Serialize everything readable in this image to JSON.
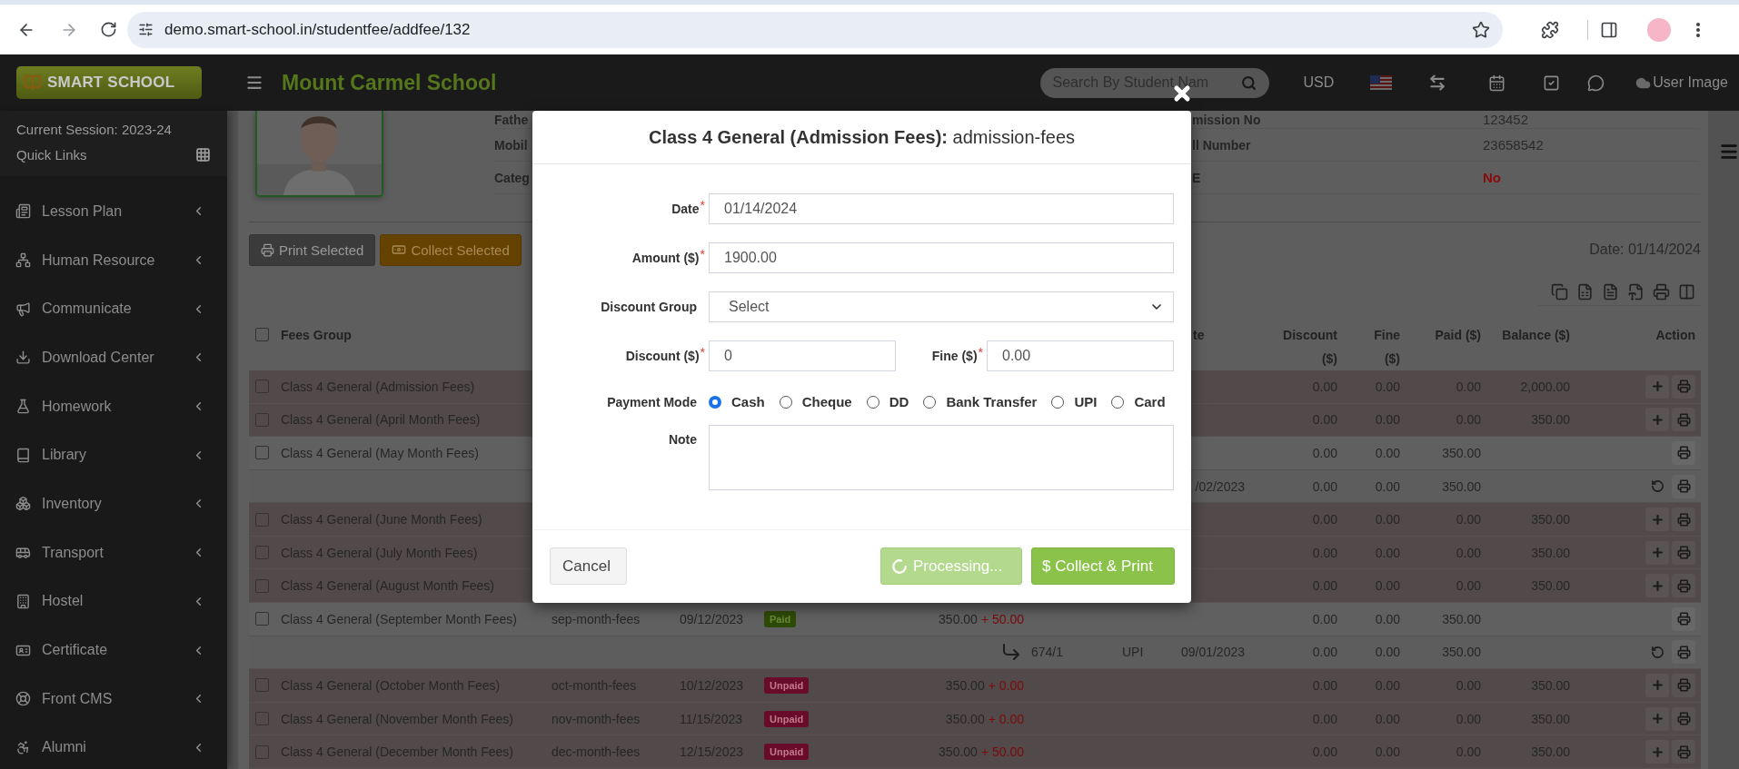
{
  "browser": {
    "url": "demo.smart-school.in/studentfee/addfee/132"
  },
  "header": {
    "logo": "SMART SCHOOL",
    "school": "Mount Carmel School",
    "search": {
      "placeholder": "Search By Student Nam"
    },
    "currency": "USD",
    "user": "User Image"
  },
  "sidebar": {
    "session": "Current Session: 2023-24",
    "quick_links": "Quick Links",
    "items": [
      {
        "label": "Lesson Plan",
        "selected": false
      },
      {
        "label": "Human Resource",
        "selected": false
      },
      {
        "label": "Communicate",
        "selected": false
      },
      {
        "label": "Download Center",
        "selected": false
      },
      {
        "label": "Homework",
        "selected": false
      },
      {
        "label": "Library",
        "selected": false
      },
      {
        "label": "Inventory",
        "selected": false
      },
      {
        "label": "Transport",
        "selected": false
      },
      {
        "label": "Hostel",
        "selected": false
      },
      {
        "label": "Certificate",
        "selected": false
      },
      {
        "label": "Front CMS",
        "selected": false
      },
      {
        "label": "Alumni",
        "selected": false
      }
    ]
  },
  "student": {
    "info_left": [
      {
        "label": "Fathe"
      },
      {
        "label": "Mobil"
      },
      {
        "label": "Categ"
      }
    ],
    "info_right": [
      {
        "label": "mission No",
        "value": "123452",
        "kind": "plain"
      },
      {
        "label": "ll Number",
        "value": "23658542",
        "kind": "plain"
      },
      {
        "label": "E",
        "value": "No",
        "kind": "alert"
      }
    ]
  },
  "toolbar": {
    "print_selected": "Print Selected",
    "collect_selected": "Collect Selected",
    "date": "Date: 01/14/2024"
  },
  "table": {
    "select_all": {
      "checked": false
    },
    "columns": [
      {
        "label": "Fees Group"
      },
      {
        "label": "te"
      },
      {
        "label": "Discount ($)"
      },
      {
        "label": "Fine ($)"
      },
      {
        "label": "Paid ($)"
      },
      {
        "label": "Balance ($)"
      },
      {
        "label": "Action"
      }
    ],
    "rows": [
      {
        "kind": "fee",
        "checked": false,
        "settled": false,
        "name": "Class 4 General (Admission Fees)",
        "discount": "0.00",
        "fine": "0.00",
        "paid": "0.00",
        "balance": "2,000.00",
        "actions": [
          {
            "kind": "collect"
          },
          {
            "kind": "print"
          }
        ]
      },
      {
        "kind": "fee",
        "checked": false,
        "settled": false,
        "name": "Class 4 General (April Month Fees)",
        "discount": "0.00",
        "fine": "0.00",
        "paid": "0.00",
        "balance": "350.00",
        "actions": [
          {
            "kind": "collect"
          },
          {
            "kind": "print"
          }
        ]
      },
      {
        "kind": "fee",
        "checked": false,
        "settled": true,
        "name": "Class 4 General (May Month Fees)",
        "discount": "0.00",
        "fine": "0.00",
        "paid": "350.00",
        "actions": [
          {
            "kind": "print"
          }
        ]
      },
      {
        "kind": "payment",
        "date": "/02/2023",
        "discount": "0.00",
        "fine": "0.00",
        "paid": "350.00",
        "actions": [
          {
            "kind": "revert"
          },
          {
            "kind": "print"
          }
        ]
      },
      {
        "kind": "fee",
        "checked": false,
        "settled": false,
        "name": "Class 4 General (June Month Fees)",
        "discount": "0.00",
        "fine": "0.00",
        "paid": "0.00",
        "balance": "350.00",
        "actions": [
          {
            "kind": "collect"
          },
          {
            "kind": "print"
          }
        ]
      },
      {
        "kind": "fee",
        "checked": false,
        "settled": false,
        "name": "Class 4 General (July Month Fees)",
        "discount": "0.00",
        "fine": "0.00",
        "paid": "0.00",
        "balance": "350.00",
        "actions": [
          {
            "kind": "collect"
          },
          {
            "kind": "print"
          }
        ]
      },
      {
        "kind": "fee",
        "checked": false,
        "settled": false,
        "name": "Class 4 General (August Month Fees)",
        "discount": "0.00",
        "fine": "0.00",
        "paid": "0.00",
        "balance": "350.00",
        "actions": [
          {
            "kind": "collect"
          },
          {
            "kind": "print"
          }
        ]
      },
      {
        "kind": "fee",
        "checked": false,
        "settled": true,
        "name": "Class 4 General (September Month Fees)",
        "code": "sep-month-fees",
        "due": "09/12/2023",
        "badge": "Paid",
        "amount": "350.00",
        "extra": "+ 50.00",
        "discount": "0.00",
        "fine": "0.00",
        "paid": "350.00",
        "actions": [
          {
            "kind": "print"
          }
        ]
      },
      {
        "kind": "payment",
        "id": "674/1",
        "mode": "UPI",
        "date": "09/01/2023",
        "discount": "0.00",
        "fine": "0.00",
        "paid": "350.00",
        "actions": [
          {
            "kind": "revert"
          },
          {
            "kind": "print"
          }
        ]
      },
      {
        "kind": "fee",
        "checked": false,
        "settled": false,
        "name": "Class 4 General (October Month Fees)",
        "code": "oct-month-fees",
        "due": "10/12/2023",
        "badge": "Unpaid",
        "amount": "350.00",
        "extra": "+ 0.00",
        "discount": "0.00",
        "fine": "0.00",
        "paid": "0.00",
        "balance": "350.00",
        "actions": [
          {
            "kind": "collect"
          },
          {
            "kind": "print"
          }
        ]
      },
      {
        "kind": "fee",
        "checked": false,
        "settled": false,
        "name": "Class 4 General (November Month Fees)",
        "code": "nov-month-fees",
        "due": "11/15/2023",
        "badge": "Unpaid",
        "amount": "350.00",
        "extra": "+ 0.00",
        "discount": "0.00",
        "fine": "0.00",
        "paid": "0.00",
        "balance": "350.00",
        "actions": [
          {
            "kind": "collect"
          },
          {
            "kind": "print"
          }
        ]
      },
      {
        "kind": "fee",
        "checked": false,
        "settled": false,
        "name": "Class 4 General (December Month Fees)",
        "code": "dec-month-fees",
        "due": "12/15/2023",
        "badge": "Unpaid",
        "amount": "350.00",
        "extra": "+ 50.00",
        "discount": "0.00",
        "fine": "0.00",
        "paid": "0.00",
        "balance": "350.00",
        "actions": [
          {
            "kind": "collect"
          },
          {
            "kind": "print"
          }
        ]
      }
    ]
  },
  "modal": {
    "title": "**Class 4 General (Admission Fees):** admission-fees",
    "fields": [
      {
        "label": "Date",
        "mark": "*",
        "value": "01/14/2024",
        "kind": "text"
      },
      {
        "label": "Amount ($)",
        "mark": "*",
        "value": "1900.00",
        "kind": "text"
      },
      {
        "label": "Discount Group",
        "value": "Select",
        "kind": "select"
      }
    ],
    "discount": {
      "label": "Discount ($)",
      "mark": "*",
      "value": "0"
    },
    "fine": {
      "label": "Fine ($)",
      "mark": "*",
      "value": "0.00"
    },
    "payment_mode": {
      "label": "Payment Mode",
      "options": [
        {
          "label": "Cash",
          "selected": true
        },
        {
          "label": "Cheque",
          "selected": false
        },
        {
          "label": "DD",
          "selected": false
        },
        {
          "label": "Bank Transfer",
          "selected": false
        },
        {
          "label": "UPI",
          "selected": false
        },
        {
          "label": "Card",
          "selected": false
        }
      ]
    },
    "note": {
      "label": "Note"
    },
    "buttons": [
      {
        "label": "Cancel",
        "kind": "cancel"
      },
      {
        "label": "Processing...",
        "kind": "processing",
        "disabled": true
      },
      {
        "label": "$ Collect & Print",
        "kind": "primary"
      }
    ]
  }
}
